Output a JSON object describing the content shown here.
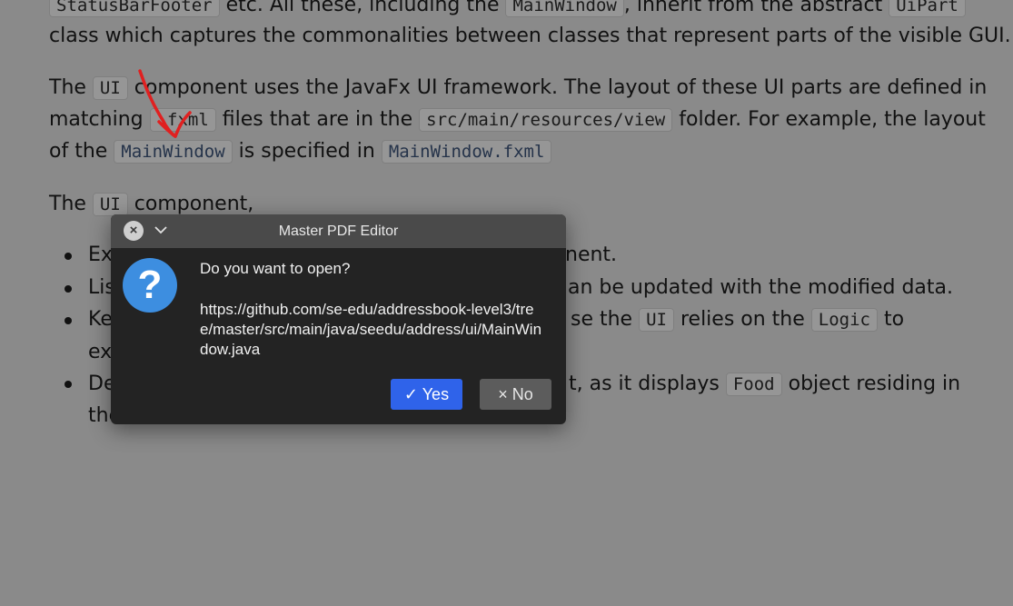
{
  "doc": {
    "line1": {
      "code1": "StatusBarFooter",
      "t1": " etc. All these, including the ",
      "code2": "MainWindow",
      "t2": ", inherit from the abstract ",
      "code3": "UiPart"
    },
    "line2": "class which captures the commonalities between classes that represent parts of the visible GUI.",
    "line3": {
      "t1": "The ",
      "code1": "UI",
      "t2": " component uses the JavaFx UI framework. The layout of these UI parts are defined in"
    },
    "line4": {
      "t1": "matching ",
      "code1": ".fxml",
      "t2": " files that are in the ",
      "code2": "src/main/resources/view",
      "t3": " folder. For example, the layout"
    },
    "line5": {
      "t1": "of the ",
      "code1": "MainWindow",
      "t2": " is specified in ",
      "code2": "MainWindow.fxml"
    },
    "line6": {
      "t1": "The ",
      "code1": "UI",
      "t2": " component,"
    },
    "bullet1": {
      "start": "Exe",
      "end": "nent."
    },
    "bullet2": {
      "start": "Lis",
      "end": "an be updated with the modified data."
    },
    "bullet3": {
      "start": "Ke",
      "mid": "se the ",
      "code1": "UI",
      "t2": " relies on the ",
      "code2": "Logic",
      "t3": " to"
    },
    "bullet3b": "exe",
    "bullet4": {
      "start": "De",
      "mid": "t, as it displays ",
      "code1": "Food",
      "t2": " object residing in"
    },
    "bullet4b": "the"
  },
  "dialog": {
    "title": "Master PDF Editor",
    "question": "Do you want to open?",
    "url": "https://github.com/se-edu/addressbook-level3/tree/master/src/main/java/seedu/address/ui/MainWindow.java",
    "yes_label": "Yes",
    "no_label": "No",
    "close_glyph": "×",
    "question_glyph": "?",
    "yes_glyph": "✓",
    "no_glyph": "×",
    "accent": "#2f63ea",
    "icon_color": "#3d8ee0"
  },
  "annotation_color": "#e02020"
}
